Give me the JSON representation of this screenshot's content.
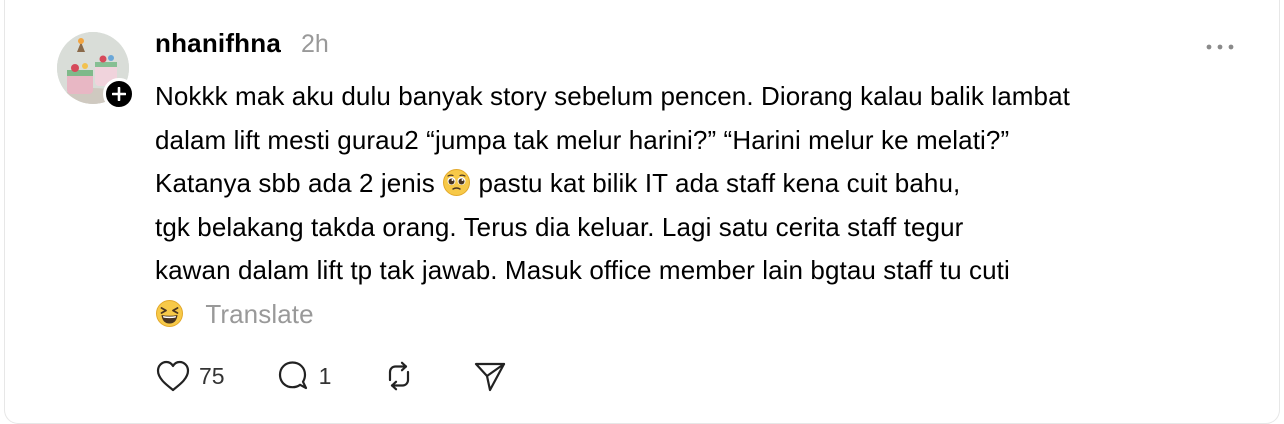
{
  "post": {
    "username": "nhanifhna",
    "time": "2h",
    "lines": [
      "Nokkk mak aku dulu banyak story sebelum pencen. Diorang kalau balik lambat",
      "dalam lift mesti gurau2 “jumpa tak melur harini?” “Harini melur ke melati?”",
      "Katanya sbb ada 2 jenis",
      "pastu kat bilik IT ada staff kena cuit bahu,",
      "tgk belakang takda orang. Terus dia keluar. Lagi satu cerita staff tegur",
      "kawan dalam lift tp tak jawab. Masuk office member lain bgtau staff tu cuti"
    ],
    "translate_label": "Translate"
  },
  "actions": {
    "likes": "75",
    "replies": "1"
  },
  "icons": {
    "avatar": "avatar-photo",
    "follow": "plus-icon",
    "more": "more-horizontal-icon",
    "emoji_1": "pleading-face-emoji",
    "emoji_2": "grinning-squinting-face-emoji",
    "like": "heart-icon",
    "reply": "comment-bubble-icon",
    "repost": "repost-icon",
    "share": "send-icon"
  },
  "colors": {
    "text": "#000000",
    "muted": "#999999",
    "border": "#e7e7e7",
    "emoji": "#f7c948"
  }
}
